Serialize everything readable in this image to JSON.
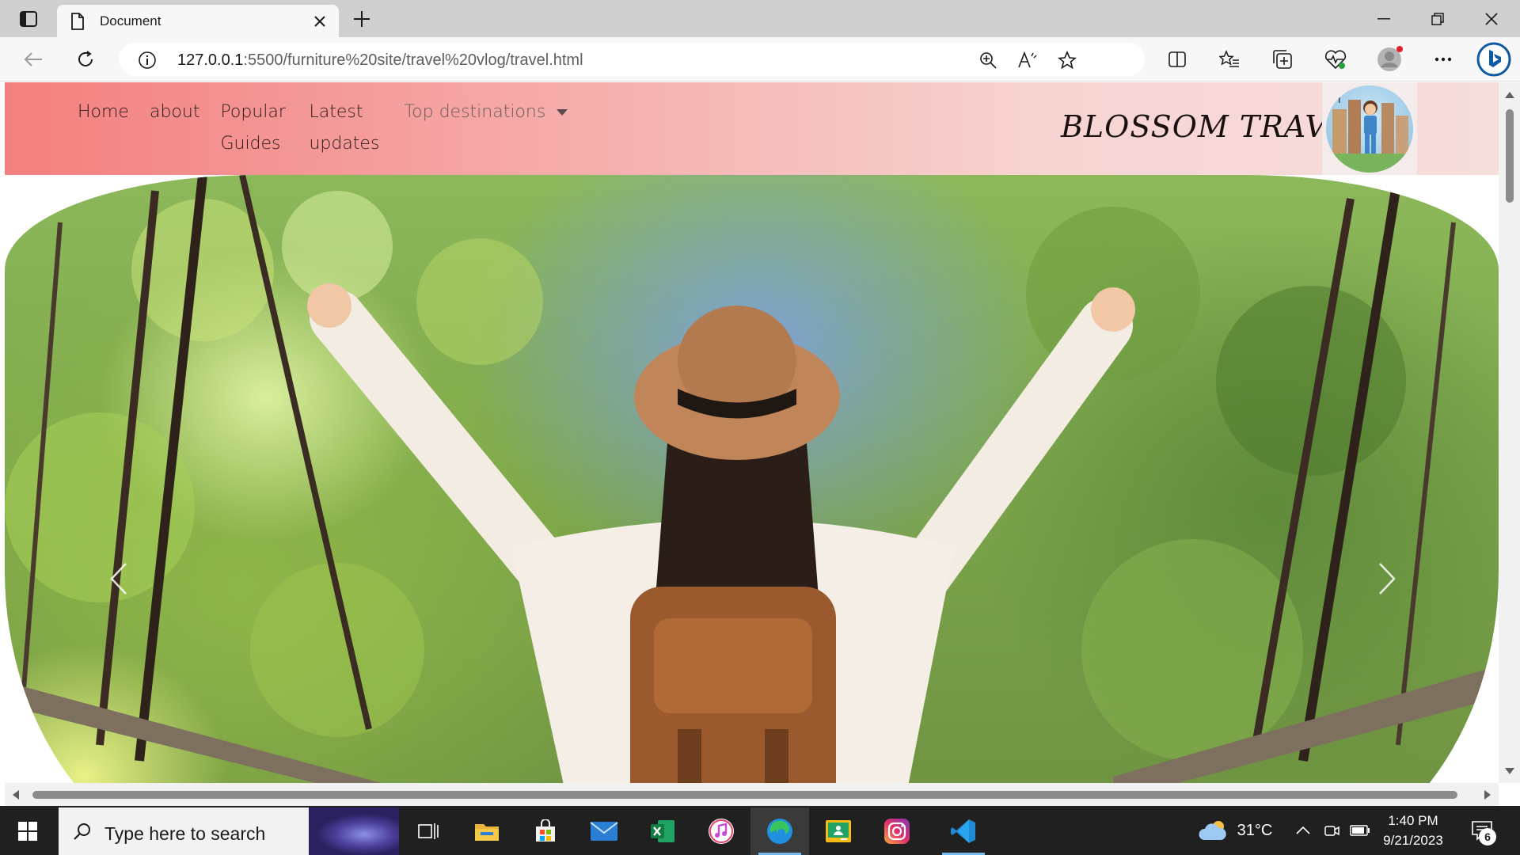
{
  "browser": {
    "tab_title": "Document",
    "url_host": "127.0.0.1",
    "url_path": ":5500/furniture%20site/travel%20vlog/travel.html"
  },
  "site": {
    "menu": [
      {
        "label": "Home"
      },
      {
        "label": "about"
      },
      {
        "label": "Popular Guides"
      },
      {
        "label": "Latest updates"
      }
    ],
    "dropdown_label": "Top destinations",
    "brand": "BLOSSOM TRAVEL"
  },
  "taskbar": {
    "search_placeholder": "Type here to search",
    "weather": "31°C",
    "time": "1:40 PM",
    "date": "9/21/2023",
    "notification_count": "6"
  },
  "colors": {
    "header_start": "#f47f7f",
    "header_end": "#f6dedc",
    "taskbar": "#202020",
    "edge_accent": "#0c59a4"
  }
}
